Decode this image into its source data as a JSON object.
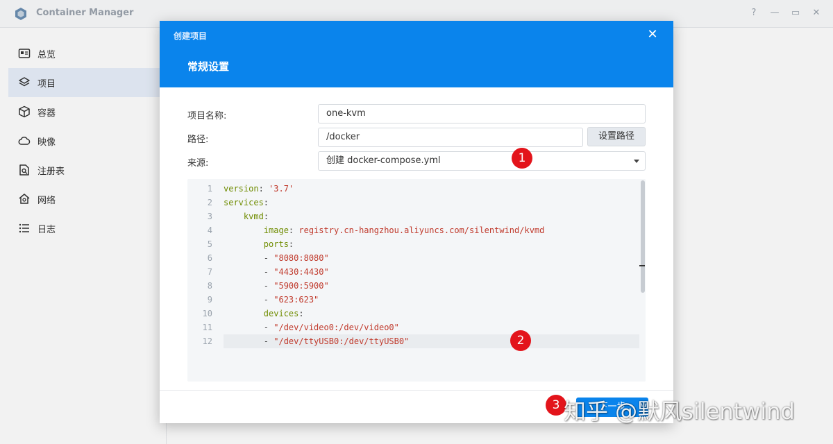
{
  "app": {
    "title": "Container Manager",
    "window_buttons": [
      "?",
      "—",
      "▭",
      "✕"
    ]
  },
  "sidebar": {
    "items": [
      {
        "label": "总览",
        "icon": "overview-icon"
      },
      {
        "label": "项目",
        "icon": "layers-icon",
        "active": true
      },
      {
        "label": "容器",
        "icon": "cube-icon"
      },
      {
        "label": "映像",
        "icon": "cloud-icon"
      },
      {
        "label": "注册表",
        "icon": "registry-icon"
      },
      {
        "label": "网络",
        "icon": "network-icon"
      },
      {
        "label": "日志",
        "icon": "list-icon"
      }
    ]
  },
  "modal": {
    "small_title": "创建项目",
    "title": "常规设置",
    "close": "✕",
    "fields": {
      "name_label": "项目名称:",
      "name_value": "one-kvm",
      "path_label": "路径:",
      "path_value": "/docker",
      "set_path_button": "设置路径",
      "source_label": "来源:",
      "source_value": "创建 docker-compose.yml"
    },
    "code": [
      {
        "n": "1",
        "tokens": [
          {
            "t": "key",
            "v": "version"
          },
          {
            "t": "plain",
            "v": ": "
          },
          {
            "t": "str",
            "v": "'3.7'"
          }
        ]
      },
      {
        "n": "2",
        "tokens": [
          {
            "t": "key",
            "v": "services"
          },
          {
            "t": "plain",
            "v": ":"
          }
        ]
      },
      {
        "n": "3",
        "tokens": [
          {
            "t": "plain",
            "v": "    "
          },
          {
            "t": "key",
            "v": "kvmd"
          },
          {
            "t": "plain",
            "v": ":"
          }
        ]
      },
      {
        "n": "4",
        "tokens": [
          {
            "t": "plain",
            "v": "        "
          },
          {
            "t": "key",
            "v": "image"
          },
          {
            "t": "plain",
            "v": ": "
          },
          {
            "t": "str",
            "v": "registry.cn-hangzhou.aliyuncs.com/silentwind/kvmd"
          }
        ]
      },
      {
        "n": "5",
        "tokens": [
          {
            "t": "plain",
            "v": "        "
          },
          {
            "t": "key",
            "v": "ports"
          },
          {
            "t": "plain",
            "v": ":"
          }
        ]
      },
      {
        "n": "6",
        "tokens": [
          {
            "t": "plain",
            "v": "        - "
          },
          {
            "t": "str",
            "v": "\"8080:8080\""
          }
        ]
      },
      {
        "n": "7",
        "tokens": [
          {
            "t": "plain",
            "v": "        - "
          },
          {
            "t": "str",
            "v": "\"4430:4430\""
          }
        ]
      },
      {
        "n": "8",
        "tokens": [
          {
            "t": "plain",
            "v": "        - "
          },
          {
            "t": "str",
            "v": "\"5900:5900\""
          }
        ]
      },
      {
        "n": "9",
        "tokens": [
          {
            "t": "plain",
            "v": "        - "
          },
          {
            "t": "str",
            "v": "\"623:623\""
          }
        ]
      },
      {
        "n": "10",
        "tokens": [
          {
            "t": "plain",
            "v": "        "
          },
          {
            "t": "key",
            "v": "devices"
          },
          {
            "t": "plain",
            "v": ":"
          }
        ]
      },
      {
        "n": "11",
        "tokens": [
          {
            "t": "plain",
            "v": "        - "
          },
          {
            "t": "str",
            "v": "\"/dev/video0:/dev/video0\""
          }
        ]
      },
      {
        "n": "12",
        "tokens": [
          {
            "t": "plain",
            "v": "        - "
          },
          {
            "t": "str",
            "v": "\"/dev/ttyUSB0:/dev/ttyUSB0\""
          }
        ],
        "current": true
      }
    ],
    "next_button": "下一步"
  },
  "steps": [
    "1",
    "2",
    "3"
  ],
  "watermark": "知乎 @默风silentwind",
  "colors": {
    "accent": "#0a84ec",
    "step_marker": "#e3141b",
    "sidebar_active": "#e8f0fb"
  }
}
